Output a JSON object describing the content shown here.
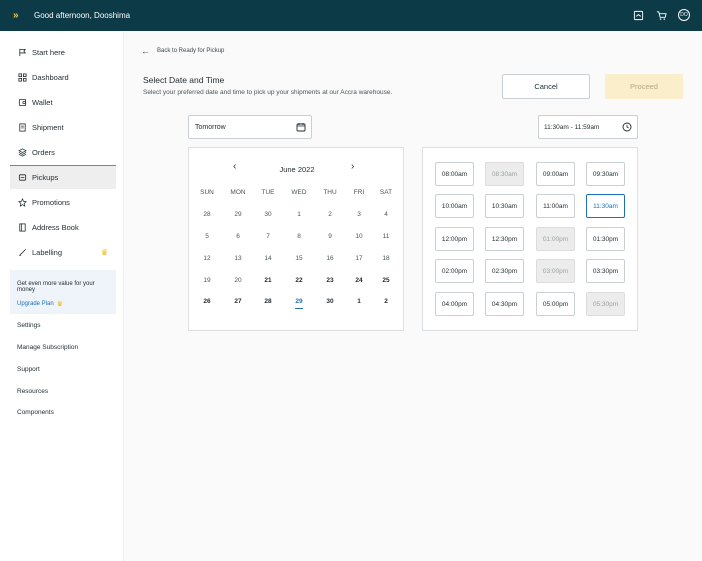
{
  "header": {
    "greeting": "Good afternoon, Dooshima",
    "avatar_initials": "DO"
  },
  "sidebar": {
    "items": [
      {
        "label": "Start here",
        "icon": "flag-icon"
      },
      {
        "label": "Dashboard",
        "icon": "grid-icon"
      },
      {
        "label": "Wallet",
        "icon": "wallet-icon"
      },
      {
        "label": "Shipment",
        "icon": "document-icon"
      },
      {
        "label": "Orders",
        "icon": "layers-icon"
      },
      {
        "label": "Pickups",
        "icon": "truck-icon"
      },
      {
        "label": "Promotions",
        "icon": "star-icon"
      },
      {
        "label": "Address Book",
        "icon": "book-icon"
      },
      {
        "label": "Labelling",
        "icon": "tag-icon"
      }
    ],
    "promo_text": "Get even more value for your money",
    "upgrade_label": "Upgrade Plan",
    "links": [
      "Settings",
      "Manage Subscription",
      "Support",
      "Resources",
      "Components"
    ]
  },
  "main": {
    "back_label": "Back to Ready for Pickup",
    "title": "Select Date and Time",
    "subtitle": "Select your preferred date and time to pick up your shipments at our Accra warehouse.",
    "cancel_label": "Cancel",
    "proceed_label": "Proceed",
    "date_value": "Tomorrow",
    "time_value": "11:30am - 11:59am"
  },
  "calendar": {
    "month": "June 2022",
    "weekdays": [
      "SUN",
      "MON",
      "TUE",
      "WED",
      "THU",
      "FRI",
      "SAT"
    ],
    "weeks": [
      [
        "28",
        "29",
        "30",
        "1",
        "2",
        "3",
        "4"
      ],
      [
        "5",
        "6",
        "7",
        "8",
        "9",
        "10",
        "11"
      ],
      [
        "12",
        "13",
        "14",
        "15",
        "16",
        "17",
        "18"
      ],
      [
        "19",
        "20",
        "21",
        "22",
        "23",
        "24",
        "25"
      ],
      [
        "26",
        "27",
        "28",
        "29",
        "30",
        "1",
        "2"
      ]
    ],
    "selected_day": "29"
  },
  "time_slots": [
    {
      "label": "08:00am",
      "state": "available"
    },
    {
      "label": "08:30am",
      "state": "disabled"
    },
    {
      "label": "09:00am",
      "state": "available"
    },
    {
      "label": "09:30am",
      "state": "available"
    },
    {
      "label": "10:00am",
      "state": "available"
    },
    {
      "label": "10:30am",
      "state": "available"
    },
    {
      "label": "11:00am",
      "state": "available"
    },
    {
      "label": "11:30am",
      "state": "selected"
    },
    {
      "label": "12:00pm",
      "state": "available"
    },
    {
      "label": "12:30pm",
      "state": "available"
    },
    {
      "label": "01:00pm",
      "state": "disabled"
    },
    {
      "label": "01:30pm",
      "state": "available"
    },
    {
      "label": "02:00pm",
      "state": "available"
    },
    {
      "label": "02:30pm",
      "state": "available"
    },
    {
      "label": "03:00pm",
      "state": "disabled"
    },
    {
      "label": "03:30pm",
      "state": "available"
    },
    {
      "label": "04:00pm",
      "state": "available"
    },
    {
      "label": "04:30pm",
      "state": "available"
    },
    {
      "label": "05:00pm",
      "state": "available"
    },
    {
      "label": "05:30pm",
      "state": "disabled"
    }
  ],
  "colors": {
    "header_bg": "#0d3a47",
    "accent": "#1d6fb8",
    "proceed_bg": "#fbeecb",
    "logo": "#f2c94c"
  }
}
